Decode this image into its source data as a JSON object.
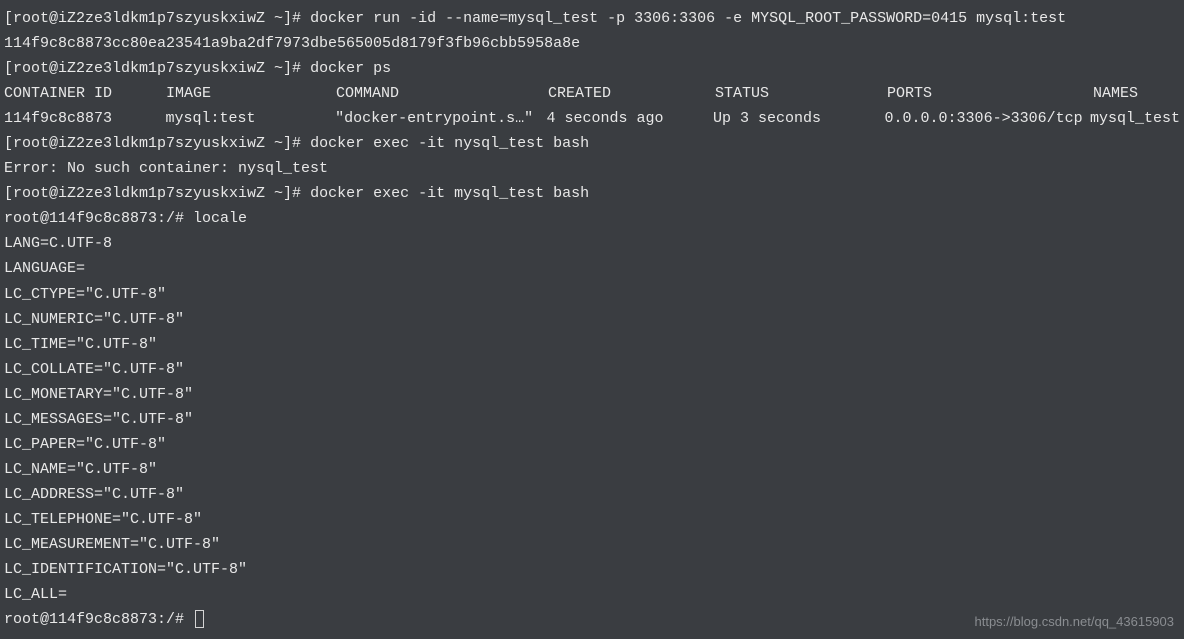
{
  "lines": {
    "l1_prompt": "[root@iZ2ze3ldkm1p7szyuskxiwZ ~]# ",
    "l1_cmd": "docker run -id --name=mysql_test -p 3306:3306 -e MYSQL_ROOT_PASSWORD=0415 mysql:test",
    "l2": "114f9c8c8873cc80ea23541a9ba2df7973dbe565005d8179f3fb96cbb5958a8e",
    "l3_prompt": "[root@iZ2ze3ldkm1p7szyuskxiwZ ~]# ",
    "l3_cmd": "docker ps",
    "l5_prompt": "[root@iZ2ze3ldkm1p7szyuskxiwZ ~]# ",
    "l5_cmd": "docker exec -it nysql_test bash",
    "l6": "Error: No such container: nysql_test",
    "l7_prompt": "[root@iZ2ze3ldkm1p7szyuskxiwZ ~]# ",
    "l7_cmd": "docker exec -it mysql_test bash",
    "l8_prompt": "root@114f9c8c8873:/# ",
    "l8_cmd": "locale",
    "locale": {
      "lang": "LANG=C.UTF-8",
      "language": "LANGUAGE=",
      "ctype": "LC_CTYPE=\"C.UTF-8\"",
      "numeric": "LC_NUMERIC=\"C.UTF-8\"",
      "time": "LC_TIME=\"C.UTF-8\"",
      "collate": "LC_COLLATE=\"C.UTF-8\"",
      "monetary": "LC_MONETARY=\"C.UTF-8\"",
      "messages": "LC_MESSAGES=\"C.UTF-8\"",
      "paper": "LC_PAPER=\"C.UTF-8\"",
      "name": "LC_NAME=\"C.UTF-8\"",
      "address": "LC_ADDRESS=\"C.UTF-8\"",
      "telephone": "LC_TELEPHONE=\"C.UTF-8\"",
      "measurement": "LC_MEASUREMENT=\"C.UTF-8\"",
      "identification": "LC_IDENTIFICATION=\"C.UTF-8\"",
      "all": "LC_ALL="
    },
    "last_prompt": "root@114f9c8c8873:/# "
  },
  "table": {
    "headers": {
      "id": "CONTAINER ID",
      "image": "IMAGE",
      "command": "COMMAND",
      "created": "CREATED",
      "status": "STATUS",
      "ports": "PORTS",
      "names": "NAMES"
    },
    "row": {
      "id": "114f9c8c8873",
      "image": "mysql:test",
      "command": "\"docker-entrypoint.s…\"",
      "created": "4 seconds ago",
      "status": "Up 3 seconds",
      "ports": "0.0.0.0:3306->3306/tcp",
      "names": "mysql_test"
    }
  },
  "watermark": "https://blog.csdn.net/qq_43615903"
}
